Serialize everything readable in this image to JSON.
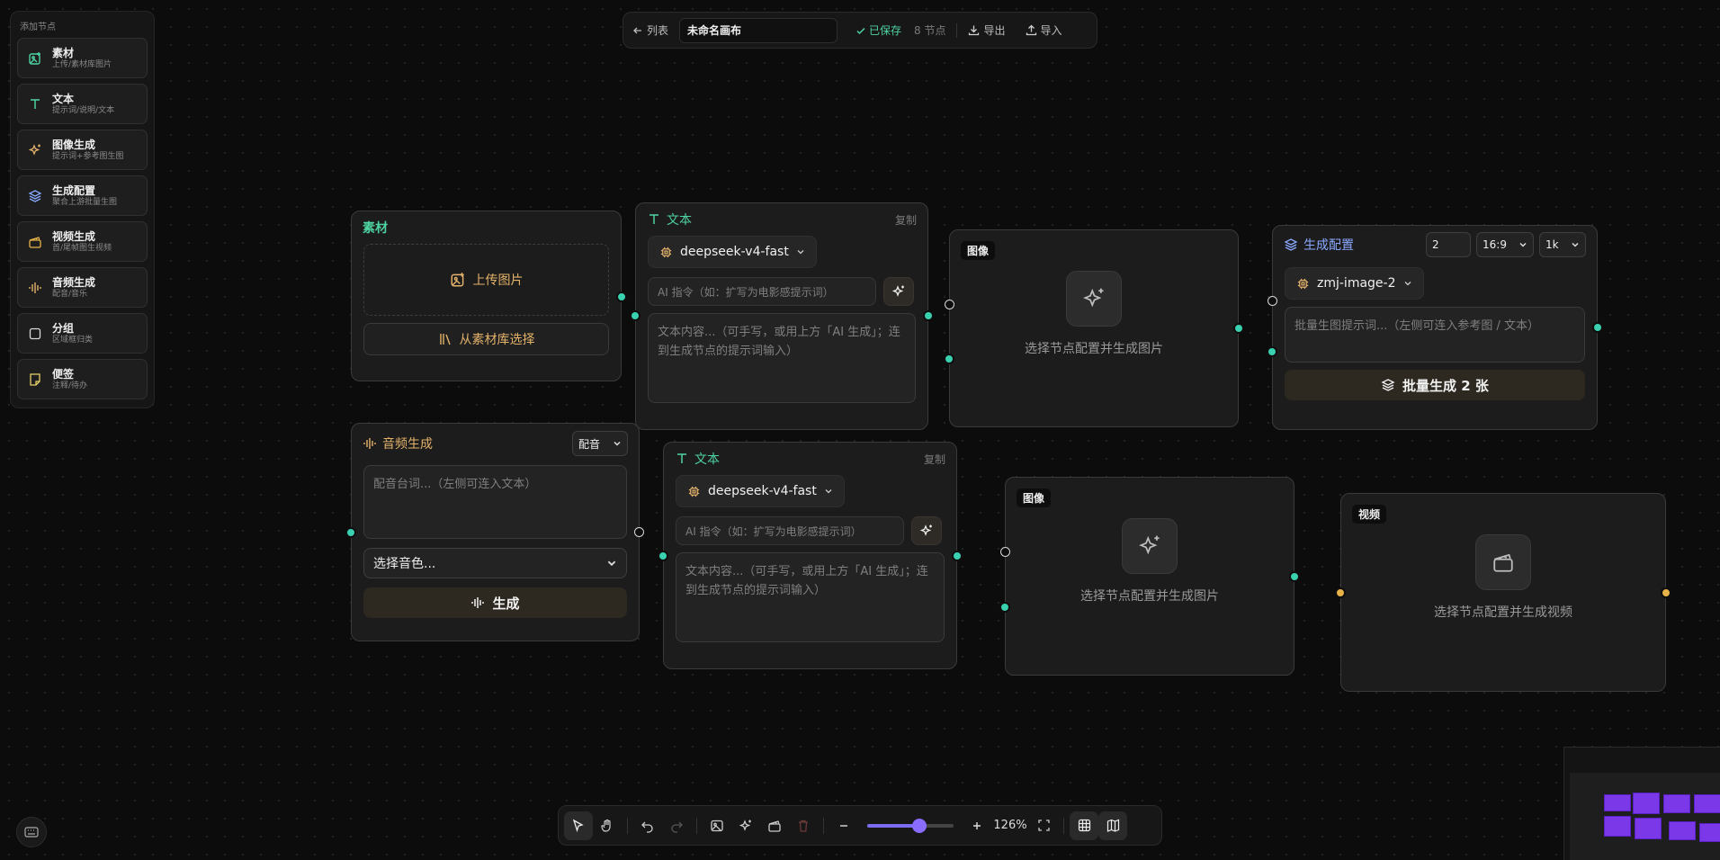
{
  "palette": {
    "title": "添加节点",
    "items": [
      {
        "label": "素材",
        "sub": "上传/素材库图片",
        "icon": "image-add-icon",
        "color": "#4ed3a2"
      },
      {
        "label": "文本",
        "sub": "提示词/说明/文本",
        "icon": "text-icon",
        "color": "#4ed3a2"
      },
      {
        "label": "图像生成",
        "sub": "提示词+参考图生图",
        "icon": "sparkles-icon",
        "color": "#e3b26b"
      },
      {
        "label": "生成配置",
        "sub": "聚合上游批量生图",
        "icon": "layers-icon",
        "color": "#8aa8ff"
      },
      {
        "label": "视频生成",
        "sub": "首/尾帧图生视频",
        "icon": "clapper-icon",
        "color": "#e8b44a"
      },
      {
        "label": "音频生成",
        "sub": "配音/音乐",
        "icon": "audio-wave-icon",
        "color": "#e3b26b"
      },
      {
        "label": "分组",
        "sub": "区域框归类",
        "icon": "group-square-icon",
        "color": "#d8d8d8"
      },
      {
        "label": "便签",
        "sub": "注释/待办",
        "icon": "sticky-note-icon",
        "color": "#e8d06a"
      }
    ]
  },
  "topbar": {
    "back_label": "列表",
    "canvas_name": "未命名画布",
    "saved_label": "已保存",
    "node_count": "8 节点",
    "export_label": "导出",
    "import_label": "导入"
  },
  "nodes": {
    "material": {
      "title": "素材",
      "upload_label": "上传图片",
      "library_label": "从素材库选择"
    },
    "text1": {
      "title": "文本",
      "copy_label": "复制",
      "model": "deepseek-v4-fast",
      "ai_placeholder": "AI 指令（如：扩写为电影感提示词）",
      "content_placeholder": "文本内容...（可手写，或用上方「AI 生成」；连到生成节点的提示词输入）"
    },
    "image1": {
      "badge": "图像",
      "hint": "选择节点配置并生成图片"
    },
    "config": {
      "title": "生成配置",
      "count": "2",
      "ratio": "16:9",
      "resolution": "1k",
      "model": "zmj-image-2",
      "prompt_placeholder": "批量生图提示词...（左侧可连入参考图 / 文本）",
      "button_label": "批量生成 2 张"
    },
    "audio": {
      "title": "音频生成",
      "mode": "配音",
      "script_placeholder": "配音台词...（左侧可连入文本）",
      "voice_placeholder": "选择音色...",
      "button_label": "生成"
    },
    "text2": {
      "title": "文本",
      "copy_label": "复制",
      "model": "deepseek-v4-fast",
      "ai_placeholder": "AI 指令（如：扩写为电影感提示词）",
      "content_placeholder": "文本内容...（可手写，或用上方「AI 生成」；连到生成节点的提示词输入）"
    },
    "image2": {
      "badge": "图像",
      "hint": "选择节点配置并生成图片"
    },
    "video": {
      "badge": "视频",
      "hint": "选择节点配置并生成视频"
    }
  },
  "toolbar": {
    "zoom_label": "126%",
    "zoom_level": 0.6
  },
  "colors": {
    "accent_teal": "#4ed3a2",
    "accent_gold": "#e3b26b",
    "accent_blue": "#8aa8ff",
    "slider_purple": "#8a6cff",
    "minimap_block": "#7b38e8"
  }
}
